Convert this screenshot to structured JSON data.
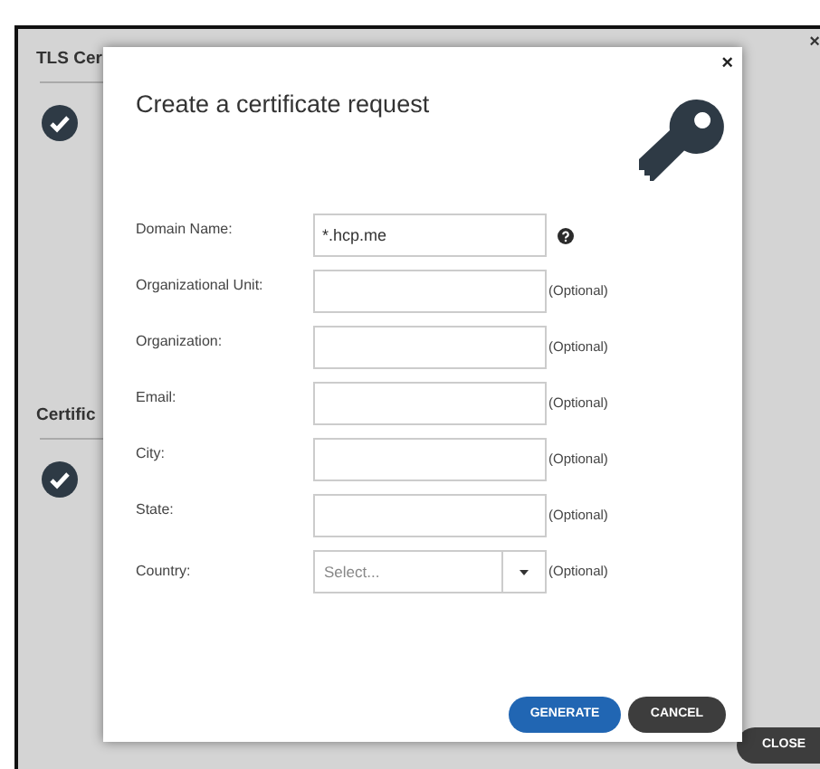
{
  "background_panel": {
    "close_symbol": "×",
    "sections": [
      {
        "title": "TLS Cer",
        "checked": true
      },
      {
        "title": "Certific",
        "checked": true
      }
    ],
    "close_button": "CLOSE"
  },
  "dialog": {
    "close_symbol": "×",
    "title": "Create a certificate request",
    "fields": [
      {
        "kind": "text",
        "label": "Domain Name:",
        "value": "*.hcp.me",
        "help": true
      },
      {
        "kind": "text",
        "label": "Organizational Unit:",
        "note": "(Optional)"
      },
      {
        "kind": "text",
        "label": "Organization:",
        "note": "(Optional)"
      },
      {
        "kind": "text",
        "label": "Email:",
        "note": "(Optional)"
      },
      {
        "kind": "text",
        "label": "City:",
        "note": "(Optional)"
      },
      {
        "kind": "text",
        "label": "State:",
        "note": "(Optional)"
      },
      {
        "kind": "select",
        "label": "Country:",
        "placeholder": "Select...",
        "note": "(Optional)"
      }
    ],
    "buttons": [
      {
        "label": "GENERATE",
        "kind": "primary"
      },
      {
        "label": "CANCEL",
        "kind": "secondary"
      }
    ]
  }
}
